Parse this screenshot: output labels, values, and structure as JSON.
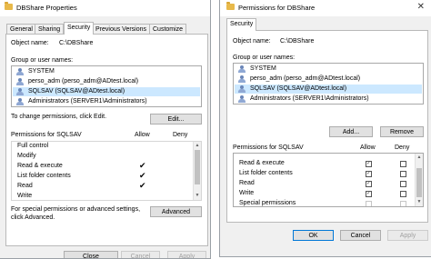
{
  "properties_dialog": {
    "title": "DBShare Properties",
    "tabs": [
      "General",
      "Sharing",
      "Security",
      "Previous Versions",
      "Customize"
    ],
    "active_tab": "Security",
    "object_name_label": "Object name:",
    "object_name_value": "C:\\DBShare",
    "group_label": "Group or user names:",
    "users": [
      "SYSTEM",
      "perso_adm (perso_adm@ADtest.local)",
      "SQLSAV (SQLSAV@ADtest.local)",
      "Administrators (SERVER1\\Administrators)"
    ],
    "selected_user": "SQLSAV (SQLSAV@ADtest.local)",
    "change_text": "To change permissions, click Edit.",
    "edit_button": "Edit...",
    "perm_header": "Permissions for SQLSAV",
    "allow_header": "Allow",
    "deny_header": "Deny",
    "permissions": [
      {
        "name": "Full control",
        "allow": false
      },
      {
        "name": "Modify",
        "allow": false
      },
      {
        "name": "Read & execute",
        "allow": true
      },
      {
        "name": "List folder contents",
        "allow": true
      },
      {
        "name": "Read",
        "allow": true
      },
      {
        "name": "Write",
        "allow": false
      }
    ],
    "special_text_1": "For special permissions or advanced settings,",
    "special_text_2": "click Advanced.",
    "advanced_button": "Advanced",
    "close_button": "Close",
    "cancel_button": "Cancel",
    "apply_button": "Apply"
  },
  "permissions_dialog": {
    "title": "Permissions for DBShare",
    "tab": "Security",
    "object_name_label": "Object name:",
    "object_name_value": "C:\\DBShare",
    "group_label": "Group or user names:",
    "users": [
      "SYSTEM",
      "perso_adm (perso_adm@ADtest.local)",
      "SQLSAV (SQLSAV@ADtest.local)",
      "Administrators (SERVER1\\Administrators)"
    ],
    "selected_user": "SQLSAV (SQLSAV@ADtest.local)",
    "add_button": "Add...",
    "remove_button": "Remove",
    "perm_header": "Permissions for SQLSAV",
    "allow_header": "Allow",
    "deny_header": "Deny",
    "permissions": [
      {
        "name": "Read & execute",
        "allow": true
      },
      {
        "name": "List folder contents",
        "allow": true
      },
      {
        "name": "Read",
        "allow": true
      },
      {
        "name": "Write",
        "allow": true
      },
      {
        "name": "Special permissions",
        "allow": false
      }
    ],
    "ok_button": "OK",
    "cancel_button": "Cancel",
    "apply_button": "Apply"
  },
  "icons": {
    "folder": "folder-icon",
    "user": "user-group-icon",
    "close": "close-icon",
    "check": "checkmark-icon"
  },
  "colors": {
    "selection": "#cce8ff",
    "primary_border": "#0078d7",
    "dialog_bg": "#f0f0f0"
  }
}
